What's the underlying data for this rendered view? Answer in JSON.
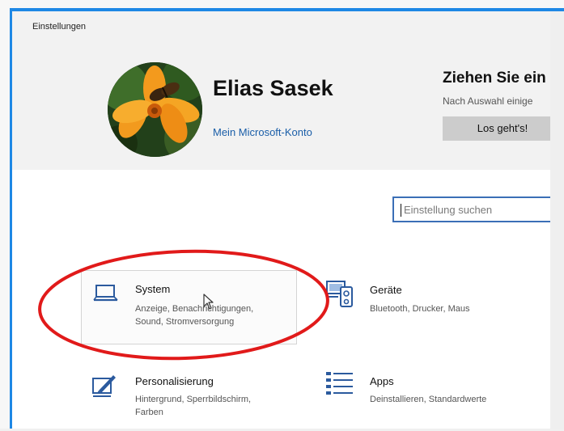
{
  "window": {
    "title": "Einstellungen"
  },
  "account": {
    "name": "Elias Sasek",
    "link": "Mein Microsoft-Konto"
  },
  "promo": {
    "title": "Ziehen Sie ein",
    "subtitle": "Nach Auswahl einige",
    "button": "Los geht's!"
  },
  "search": {
    "placeholder": "Einstellung suchen"
  },
  "categories": [
    {
      "title": "System",
      "desc": [
        "Anzeige, Benachrichtigungen,",
        "Sound, Stromversorgung"
      ],
      "icon": "laptop-icon"
    },
    {
      "title": "Geräte",
      "desc": [
        "Bluetooth, Drucker, Maus"
      ],
      "icon": "devices-icon"
    },
    {
      "title": "Personalisierung",
      "desc": [
        "Hintergrund, Sperrbildschirm,",
        "Farben"
      ],
      "icon": "personalization-icon"
    },
    {
      "title": "Apps",
      "desc": [
        "Deinstallieren, Standardwerte"
      ],
      "icon": "apps-icon"
    }
  ],
  "colors": {
    "accent": "#1e88e5",
    "link": "#1a5ea8",
    "icon": "#2b5a9e",
    "annotation": "#e11a1a"
  }
}
